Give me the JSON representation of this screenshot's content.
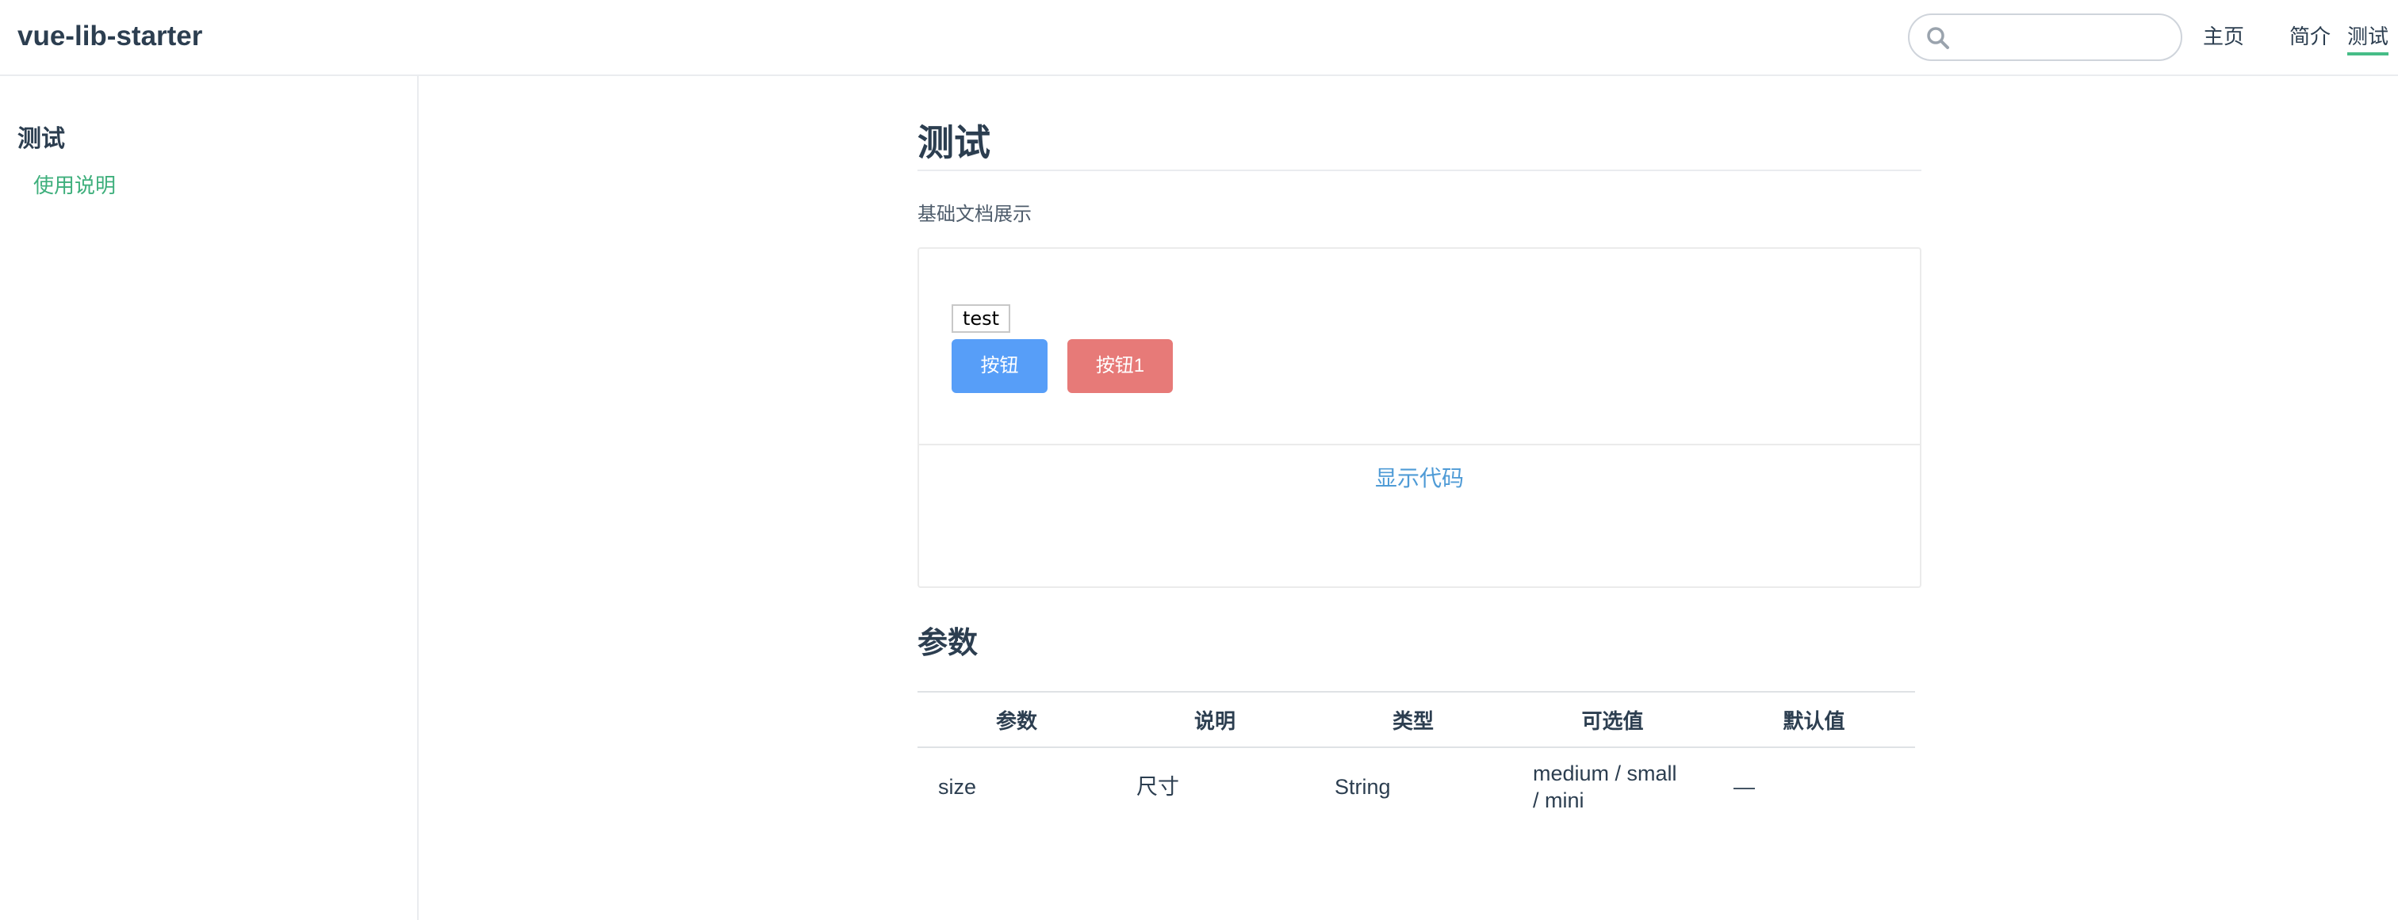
{
  "navbar": {
    "site_name": "vue-lib-starter",
    "search": {
      "placeholder": "",
      "value": ""
    },
    "links": [
      {
        "label": "主页",
        "active": false
      },
      {
        "label": "简介",
        "active": false
      },
      {
        "label": "测试",
        "active": true
      }
    ],
    "active_color": "#46bd87"
  },
  "sidebar": {
    "group_title": "测试",
    "items": [
      {
        "label": "使用说明",
        "active": true
      }
    ],
    "link_color": "#3eaf7c"
  },
  "main": {
    "title": "测试",
    "description": "基础文档展示",
    "demo": {
      "label_text": "test",
      "buttons": [
        {
          "label": "按钮",
          "color": "#579ef8"
        },
        {
          "label": "按钮1",
          "color": "#e77a78"
        }
      ],
      "toggle_code_label": "显示代码"
    },
    "params_section": {
      "title": "参数",
      "columns": [
        "参数",
        "说明",
        "类型",
        "可选值",
        "默认值"
      ],
      "rows": [
        [
          "size",
          "尺寸",
          "String",
          "medium / small / mini",
          "—"
        ]
      ]
    }
  }
}
